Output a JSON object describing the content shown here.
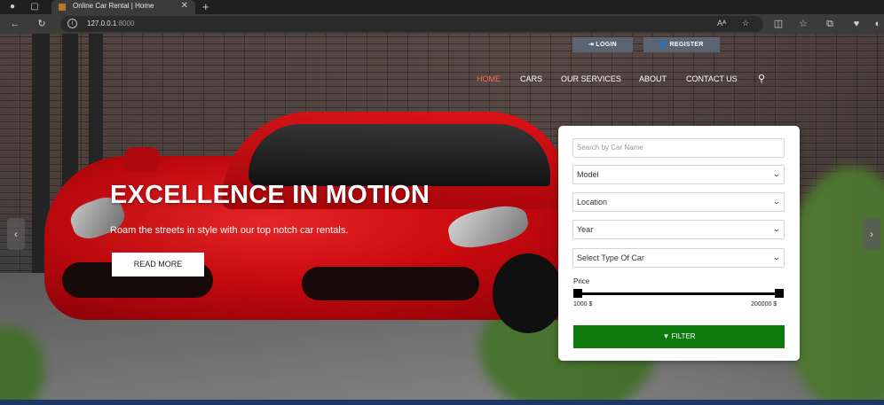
{
  "browser": {
    "tab_title": "Online Car Rental | Home",
    "tab_close": "✕",
    "new_tab": "+",
    "url_host": "127.0.0.1",
    "url_port": ":8000",
    "icons": {
      "back": "←",
      "reload": "↻",
      "read_aloud": "Aᴬ",
      "favorite": "☆"
    }
  },
  "header": {
    "login_label": "LOGIN",
    "login_icon": "⇥",
    "register_label": "REGISTER",
    "register_icon": "👤"
  },
  "nav": {
    "items": [
      {
        "label": "HOME",
        "active": true
      },
      {
        "label": "CARS"
      },
      {
        "label": "OUR SERVICES"
      },
      {
        "label": "ABOUT"
      },
      {
        "label": "CONTACT US"
      }
    ],
    "search_icon": "🔍"
  },
  "hero": {
    "headline": "EXCELLENCE IN MOTION",
    "subline": "Roam the streets in style with our top notch car rentals.",
    "cta_label": "READ MORE",
    "prev_arrow": "‹",
    "next_arrow": "›"
  },
  "filter": {
    "search_placeholder": "Search by Car Name",
    "model": "Model",
    "location": "Location",
    "year": "Year",
    "car_type": "Select Type Of Car",
    "price_label": "Price",
    "price_min": "1000 $",
    "price_max": "200000 $",
    "button_label": "FILTER",
    "button_icon": "▼"
  },
  "colors": {
    "active_nav": "#ff6b5a",
    "filter_button": "#0e7a0e",
    "auth_button": "#5a6473"
  }
}
